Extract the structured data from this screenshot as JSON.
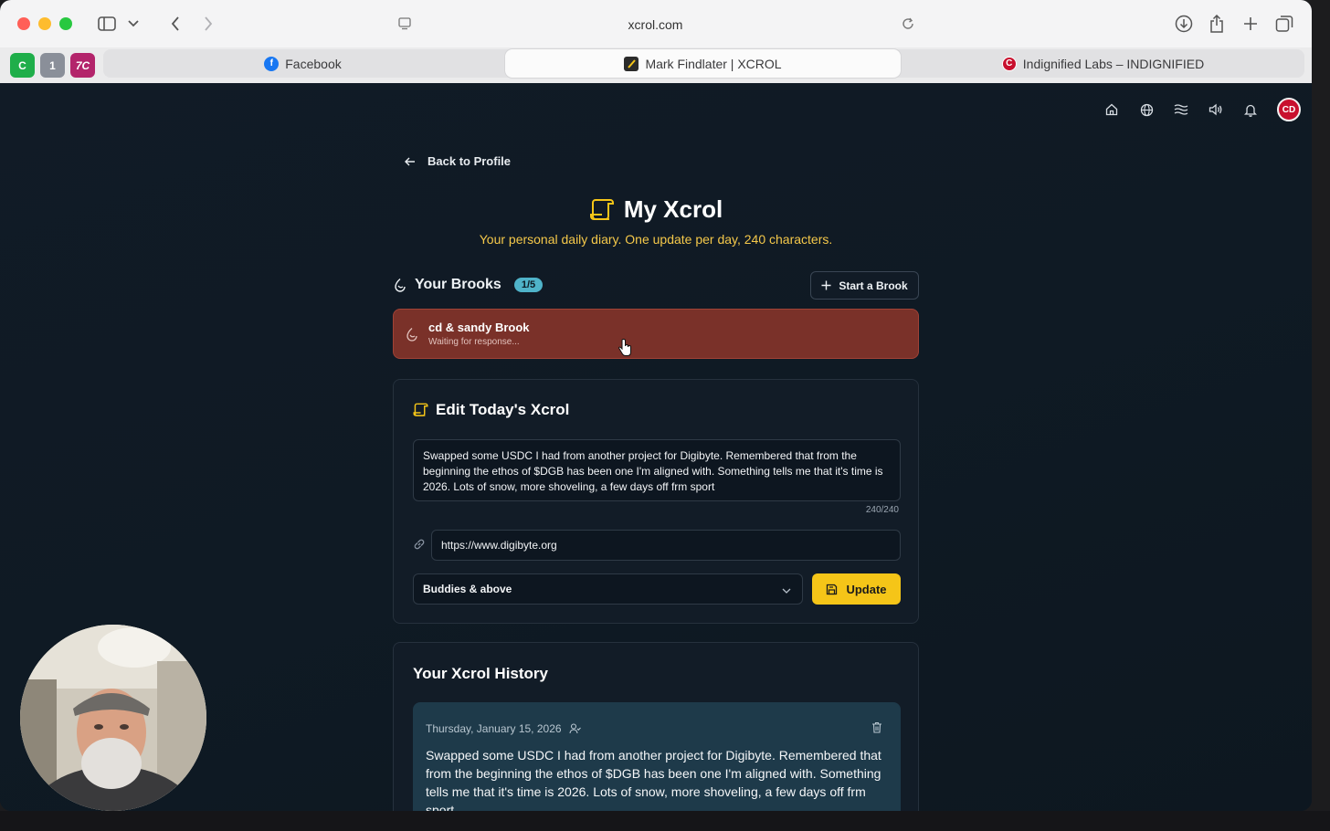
{
  "browser": {
    "address": "xcrol.com",
    "pinned_tabs": [
      {
        "label": "C",
        "color": "#1fae4a"
      },
      {
        "label": "1",
        "color": "#8a8f99"
      },
      {
        "label": "7C",
        "color": "#b3246b"
      }
    ],
    "tabs": [
      {
        "label": "Facebook",
        "active": false
      },
      {
        "label": "Mark Findlater | XCROL",
        "active": true
      },
      {
        "label": "Indignified Labs – INDIGNIFIED",
        "active": false
      }
    ]
  },
  "nav": {
    "icons": [
      "home-icon",
      "globe-icon",
      "waves-icon",
      "volume-icon",
      "bell-icon"
    ],
    "avatar_label": "CD"
  },
  "back_label": "Back to Profile",
  "page": {
    "title": "My Xcrol",
    "subtitle": "Your personal daily diary. One update per day, 240 characters."
  },
  "brooks": {
    "title": "Your Brooks",
    "count_badge": "1/5",
    "start_label": "Start a Brook",
    "items": [
      {
        "name": "cd & sandy Brook",
        "status": "Waiting for response..."
      }
    ]
  },
  "editor": {
    "title": "Edit Today's Xcrol",
    "text": "Swapped some USDC I had from another project for Digibyte. Remembered that from the beginning the ethos of $DGB has been one I'm aligned with. Something tells me that it's time is 2026. Lots of snow, more shoveling, a few days off frm sport",
    "counter": "240/240",
    "link": "https://www.digibyte.org",
    "visibility": "Buddies & above",
    "update_label": "Update"
  },
  "history": {
    "title": "Your Xcrol History",
    "entries": [
      {
        "date": "Thursday, January 15, 2026",
        "text": "Swapped some USDC I had from another project for Digibyte. Remembered that from the beginning the ethos of $DGB has been one I'm aligned with. Something tells me that it's time is 2026. Lots of snow, more shoveling, a few days off frm sport"
      }
    ]
  },
  "colors": {
    "accent": "#f5c518",
    "brook_card": "#7a3129",
    "badge": "#4fb3c9",
    "history_card": "#1e3a4a"
  }
}
